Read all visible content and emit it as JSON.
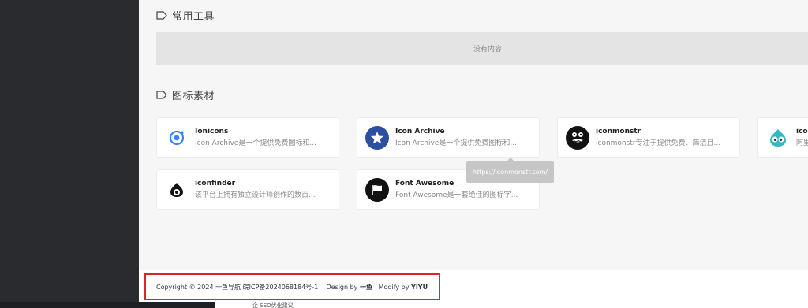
{
  "sections": {
    "tools": {
      "title": "常用工具",
      "empty_text": "没有内容"
    },
    "icons": {
      "title": "图标素材"
    }
  },
  "cards": [
    {
      "name": "Ionicons",
      "desc": "Icon Archive是一个提供免费图标和...",
      "icon": "ionicons-logo-icon",
      "color": "#3b82f6"
    },
    {
      "name": "Icon Archive",
      "desc": "Icon Archive是一个提供免费图标和...",
      "icon": "star-logo-icon",
      "color": "#2d4fa0"
    },
    {
      "name": "iconmonstr",
      "desc": "iconmonstr专注于提供免费、简洁且...",
      "icon": "monster-logo-icon",
      "color": "#111111"
    },
    {
      "name": "ico",
      "desc": "阿里",
      "icon": "iconfont-logo-icon",
      "color": "#35b8c4"
    },
    {
      "name": "iconfinder",
      "desc": "该平台上拥有独立设计师创作的数百...",
      "icon": "iconfinder-logo-icon",
      "color": "#111111"
    },
    {
      "name": "Font Awesome",
      "desc": "Font Awesome是一套绝佳的图标字...",
      "icon": "flag-logo-icon",
      "color": "#111111"
    }
  ],
  "tooltip": {
    "text": "https://iconmonstr.com/"
  },
  "footer": {
    "copyright": "Copyright © 2024 一鱼导航 皖ICP备2024068184号-1",
    "design_label": "Design by",
    "design_name": "一鱼",
    "modify_label": "Modify by",
    "modify_name": "YIYU"
  },
  "bottom_snippet": "企 SEO优化建议"
}
